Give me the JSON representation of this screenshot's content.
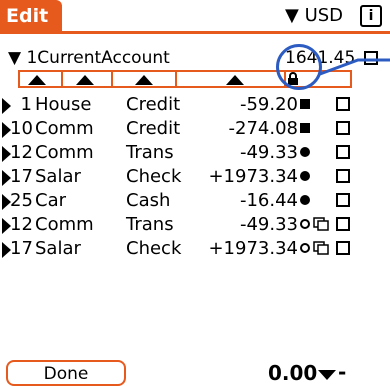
{
  "header": {
    "title": "Edit",
    "currency": "USD",
    "info_icon_label": "i"
  },
  "account": {
    "name": "1CurrentAccount",
    "balance": "1641.45"
  },
  "rows": [
    {
      "date": "1",
      "payee": "House",
      "category": "Credit",
      "amount": "-59.20",
      "mark": "square",
      "dup": false
    },
    {
      "date": "10",
      "payee": "Comm",
      "category": "Credit",
      "amount": "-274.08",
      "mark": "square",
      "dup": false
    },
    {
      "date": "12",
      "payee": "Comm",
      "category": "Trans",
      "amount": "-49.33",
      "mark": "dot",
      "dup": false
    },
    {
      "date": "17",
      "payee": "Salar",
      "category": "Check",
      "amount": "+1973.34",
      "mark": "dot",
      "dup": false
    },
    {
      "date": "25",
      "payee": "Car",
      "category": "Cash",
      "amount": "-16.44",
      "mark": "dot",
      "dup": false
    },
    {
      "date": "12",
      "payee": "Comm",
      "category": "Trans",
      "amount": "-49.33",
      "mark": "ring",
      "dup": true
    },
    {
      "date": "17",
      "payee": "Salar",
      "category": "Check",
      "amount": "+1973.34",
      "mark": "ring",
      "dup": true
    }
  ],
  "footer": {
    "done_label": "Done",
    "total": "0.00",
    "dash": "-"
  },
  "colors": {
    "accent": "#e65a1e",
    "highlight": "#2c5cc2"
  }
}
